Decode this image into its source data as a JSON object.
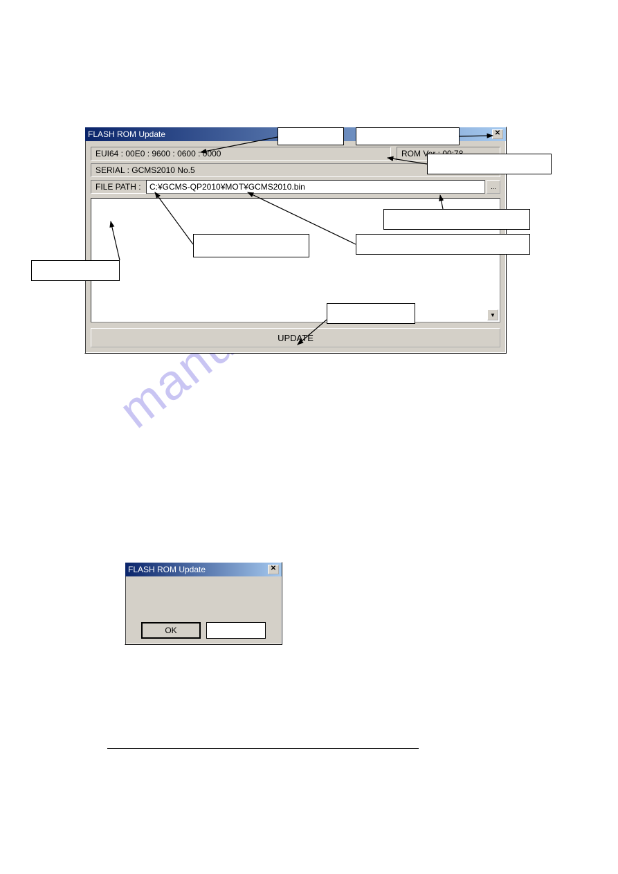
{
  "main_window": {
    "title": "FLASH ROM Update",
    "eui64": "EUI64 : 00E0 : 9600 : 0600 : 0000",
    "rom_ver": "ROM Ver : 00:78",
    "serial": "SERIAL :    GCMS2010 No.5",
    "file_path_label": "FILE PATH :",
    "file_path_value": "C:¥GCMS-QP2010¥MOT¥GCMS2010.bin",
    "browse_label": "...",
    "update_label": "UPDATE",
    "scroll_glyph": "▼"
  },
  "small_dialog": {
    "title": "FLASH ROM Update",
    "ok_label": "OK"
  },
  "watermark_text": "manualshive.com",
  "close_glyph": "✕"
}
